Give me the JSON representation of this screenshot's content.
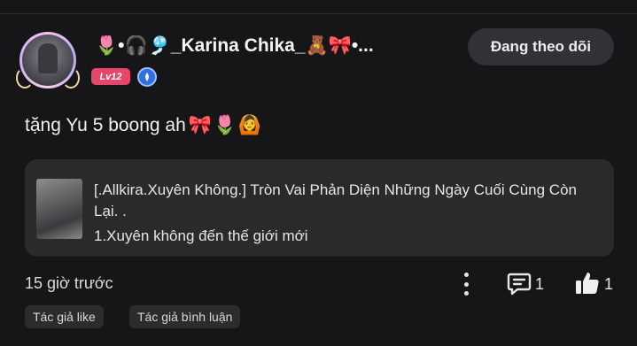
{
  "user": {
    "display_name": "🌷•🎧🎐_Karina Chika_🧸🎀•...",
    "level": "Lv12"
  },
  "follow_button": {
    "label": "Đang theo dõi"
  },
  "comment": {
    "text": "tặng Yu 5 boong ah",
    "emojis": [
      "🎀",
      "🌷",
      "🙆"
    ]
  },
  "linked_work": {
    "title": "[.Allkira.Xuyên Không.] Tròn Vai Phản Diện Những Ngày Cuối Cùng Còn Lại. .",
    "chapter": "1.Xuyên không đến thế giới mới"
  },
  "footer": {
    "timestamp": "15 giờ trước",
    "reply_count": "1",
    "like_count": "1"
  },
  "tags": [
    "Tác giả like",
    "Tác giả bình luận"
  ],
  "colors": {
    "background": "#161618",
    "level_badge": "#e6456c",
    "follow_button_bg": "#323236",
    "card_bg": "#2a2a2d"
  },
  "icons": [
    "more-vertical-icon",
    "reply-comment-icon",
    "thumbs-up-icon",
    "verified-icon"
  ]
}
